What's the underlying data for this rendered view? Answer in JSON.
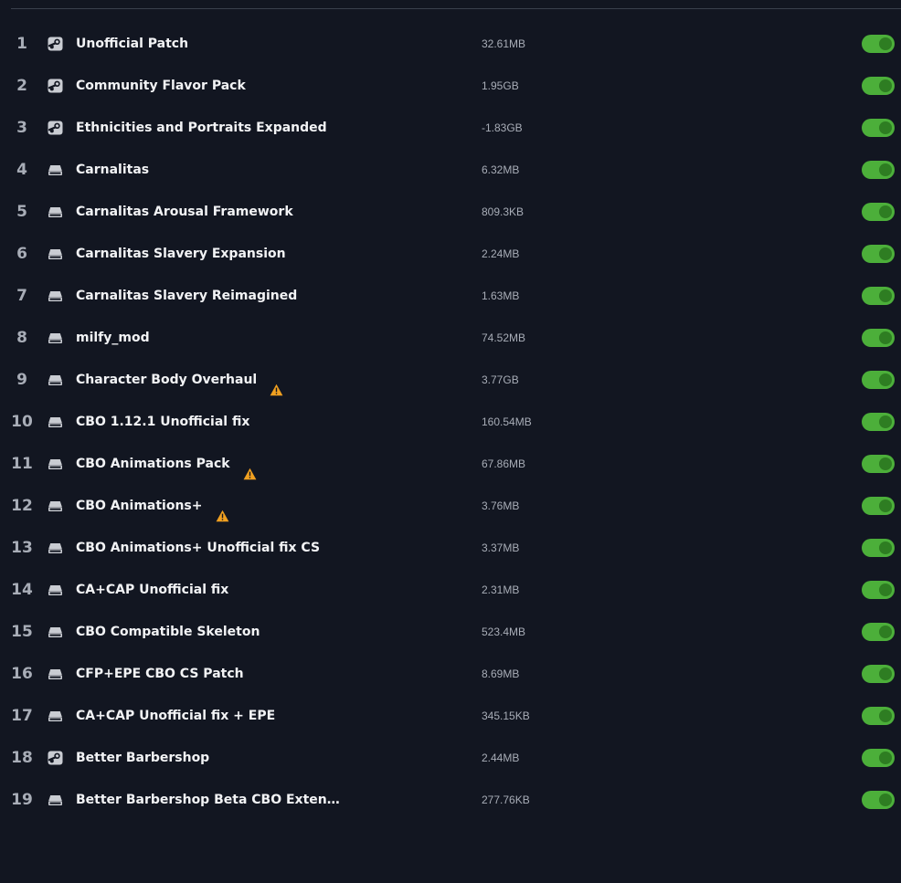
{
  "mods": [
    {
      "index": "1",
      "source": "steam",
      "name": "Unofficial Patch",
      "warning": false,
      "size": "32.61MB",
      "enabled": true
    },
    {
      "index": "2",
      "source": "steam",
      "name": "Community Flavor Pack",
      "warning": false,
      "size": "1.95GB",
      "enabled": true
    },
    {
      "index": "3",
      "source": "steam",
      "name": "Ethnicities and Portraits Expanded",
      "warning": false,
      "size": "-1.83GB",
      "enabled": true
    },
    {
      "index": "4",
      "source": "local",
      "name": "Carnalitas",
      "warning": false,
      "size": "6.32MB",
      "enabled": true
    },
    {
      "index": "5",
      "source": "local",
      "name": "Carnalitas Arousal Framework",
      "warning": false,
      "size": "809.3KB",
      "enabled": true
    },
    {
      "index": "6",
      "source": "local",
      "name": "Carnalitas Slavery Expansion",
      "warning": false,
      "size": "2.24MB",
      "enabled": true
    },
    {
      "index": "7",
      "source": "local",
      "name": "Carnalitas Slavery Reimagined",
      "warning": false,
      "size": "1.63MB",
      "enabled": true
    },
    {
      "index": "8",
      "source": "local",
      "name": "milfy_mod",
      "warning": false,
      "size": "74.52MB",
      "enabled": true
    },
    {
      "index": "9",
      "source": "local",
      "name": "Character Body Overhaul",
      "warning": true,
      "size": "3.77GB",
      "enabled": true
    },
    {
      "index": "10",
      "source": "local",
      "name": "CBO 1.12.1 Unofficial fix",
      "warning": false,
      "size": "160.54MB",
      "enabled": true
    },
    {
      "index": "11",
      "source": "local",
      "name": "CBO Animations Pack",
      "warning": true,
      "size": "67.86MB",
      "enabled": true
    },
    {
      "index": "12",
      "source": "local",
      "name": "CBO Animations+",
      "warning": true,
      "size": "3.76MB",
      "enabled": true
    },
    {
      "index": "13",
      "source": "local",
      "name": "CBO Animations+ Unofficial fix CS",
      "warning": false,
      "size": "3.37MB",
      "enabled": true
    },
    {
      "index": "14",
      "source": "local",
      "name": "CA+CAP Unofficial fix",
      "warning": false,
      "size": "2.31MB",
      "enabled": true
    },
    {
      "index": "15",
      "source": "local",
      "name": "CBO Compatible Skeleton",
      "warning": false,
      "size": "523.4MB",
      "enabled": true
    },
    {
      "index": "16",
      "source": "local",
      "name": "CFP+EPE CBO CS Patch",
      "warning": false,
      "size": "8.69MB",
      "enabled": true
    },
    {
      "index": "17",
      "source": "local",
      "name": "CA+CAP Unofficial fix + EPE",
      "warning": false,
      "size": "345.15KB",
      "enabled": true
    },
    {
      "index": "18",
      "source": "steam",
      "name": "Better Barbershop",
      "warning": false,
      "size": "2.44MB",
      "enabled": true
    },
    {
      "index": "19",
      "source": "local",
      "name": "Better Barbershop Beta CBO Exten…",
      "warning": false,
      "size": "277.76KB",
      "enabled": true
    }
  ],
  "colors": {
    "background": "#121621",
    "toggle_on": "#4caf3a",
    "warning": "#f0a020",
    "text_primary": "#f2f3f5",
    "text_secondary": "#a8adb7"
  }
}
